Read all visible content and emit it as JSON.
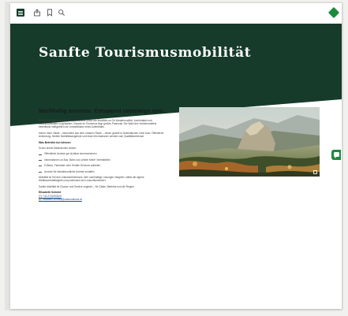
{
  "colors": {
    "brand_dark_green": "#163b2b",
    "brand_green": "#1e8a3c",
    "link": "#1a4d8f"
  },
  "toolbar": {
    "icons": [
      "menu-icon",
      "share-icon",
      "bookmark-icon",
      "search-icon",
      "logo-icon"
    ]
  },
  "hero": {
    "title": "Sanfte Tourismusmobilität"
  },
  "article": {
    "headline": "Nachhaltig anreisen. Entspannt unterwegs sein.",
    "intro": "Sanfte Mobilität bedeutet, An- und Abreise sowie die Mobilität vor Ort klimafreundlich, komfortabel und zukunftsorientiert zu gestalten. Gerade im Tourismus liegt großes Potenzial: Die Wahl des Verkehrsmittels beeinflusst maßgeblich die Umweltbilanz eines Aufenthalts.",
    "paragraph2": "Immer mehr Gäste – besonders aus dem urbanen Raum – reisen gezielt in Destinationen ohne Auto. Öffentliche Anbindung, flexible Mobilitätsangebote und klare Informationen werden zum Qualitätsmerkmal.",
    "subheading": "Was Betriebe tun können",
    "list_intro": "Schon kleine Maßnahmen wirken:",
    "bullets": [
      "Öffentliche Anreise gut sichtbar kommunizieren",
      "Informationen zu Bus, Bahn und „letzter Meile“ bereitstellen",
      "E-Bikes, Fahrräder oder Shuttle-Services anbieten",
      "Anreize für klimafreundliche Anreise schaffen"
    ],
    "paragraph3": "Mobilität ist Teil des Urlaubserlebnisses. Wer nachhaltige Lösungen integriert, stärkt die eigene Wettbewerbsfähigkeit und positioniert sich zukunftsorientiert.",
    "paragraph4": "Sanfte Mobilität ist Chance und Service zugleich – für Gäste, Betriebe und die Region.",
    "contact": {
      "name": "Elisabeth Schmid",
      "phone_prefix": "(T)",
      "phone": "+43 2742/9000/0",
      "email_prefix": "(E)",
      "email": "elisabeth.schmid@noetourismus.at"
    }
  }
}
